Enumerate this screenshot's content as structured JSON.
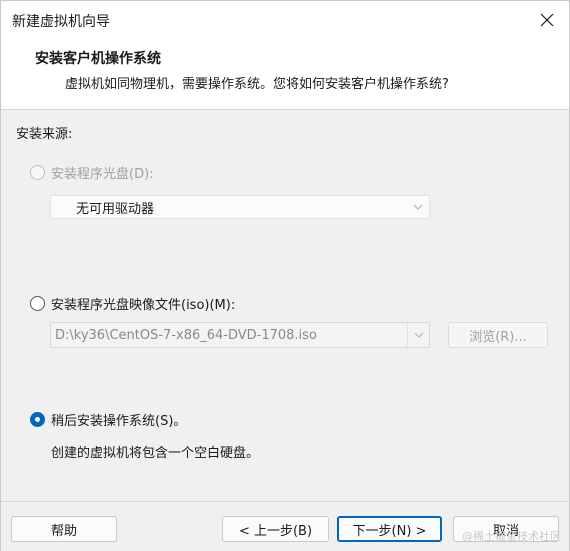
{
  "window": {
    "title": "新建虚拟机向导"
  },
  "header": {
    "title": "安装客户机操作系统",
    "description": "虚拟机如同物理机，需要操作系统。您将如何安装客户机操作系统?"
  },
  "source": {
    "label": "安装来源:",
    "options": [
      {
        "label": "安装程序光盘(D):",
        "state": "disabled"
      },
      {
        "label": "安装程序光盘映像文件(iso)(M):",
        "state": "unchecked"
      },
      {
        "label": "稍后安装操作系统(S)。",
        "state": "checked"
      }
    ],
    "drive_select_value": "无可用驱动器",
    "iso_path_value": "D:\\ky36\\CentOS-7-x86_64-DVD-1708.iso",
    "browse_label": "浏览(R)...",
    "later_description": "创建的虚拟机将包含一个空白硬盘。"
  },
  "footer": {
    "help_label": "帮助",
    "back_label": "< 上一步(B)",
    "next_label": "下一步(N) >",
    "cancel_label": "取消"
  },
  "watermark": "@稀土掘金技术社区",
  "colors": {
    "accent": "#0067c0",
    "disabled_text": "#a0a0a0",
    "background": "#f0f0f0"
  }
}
